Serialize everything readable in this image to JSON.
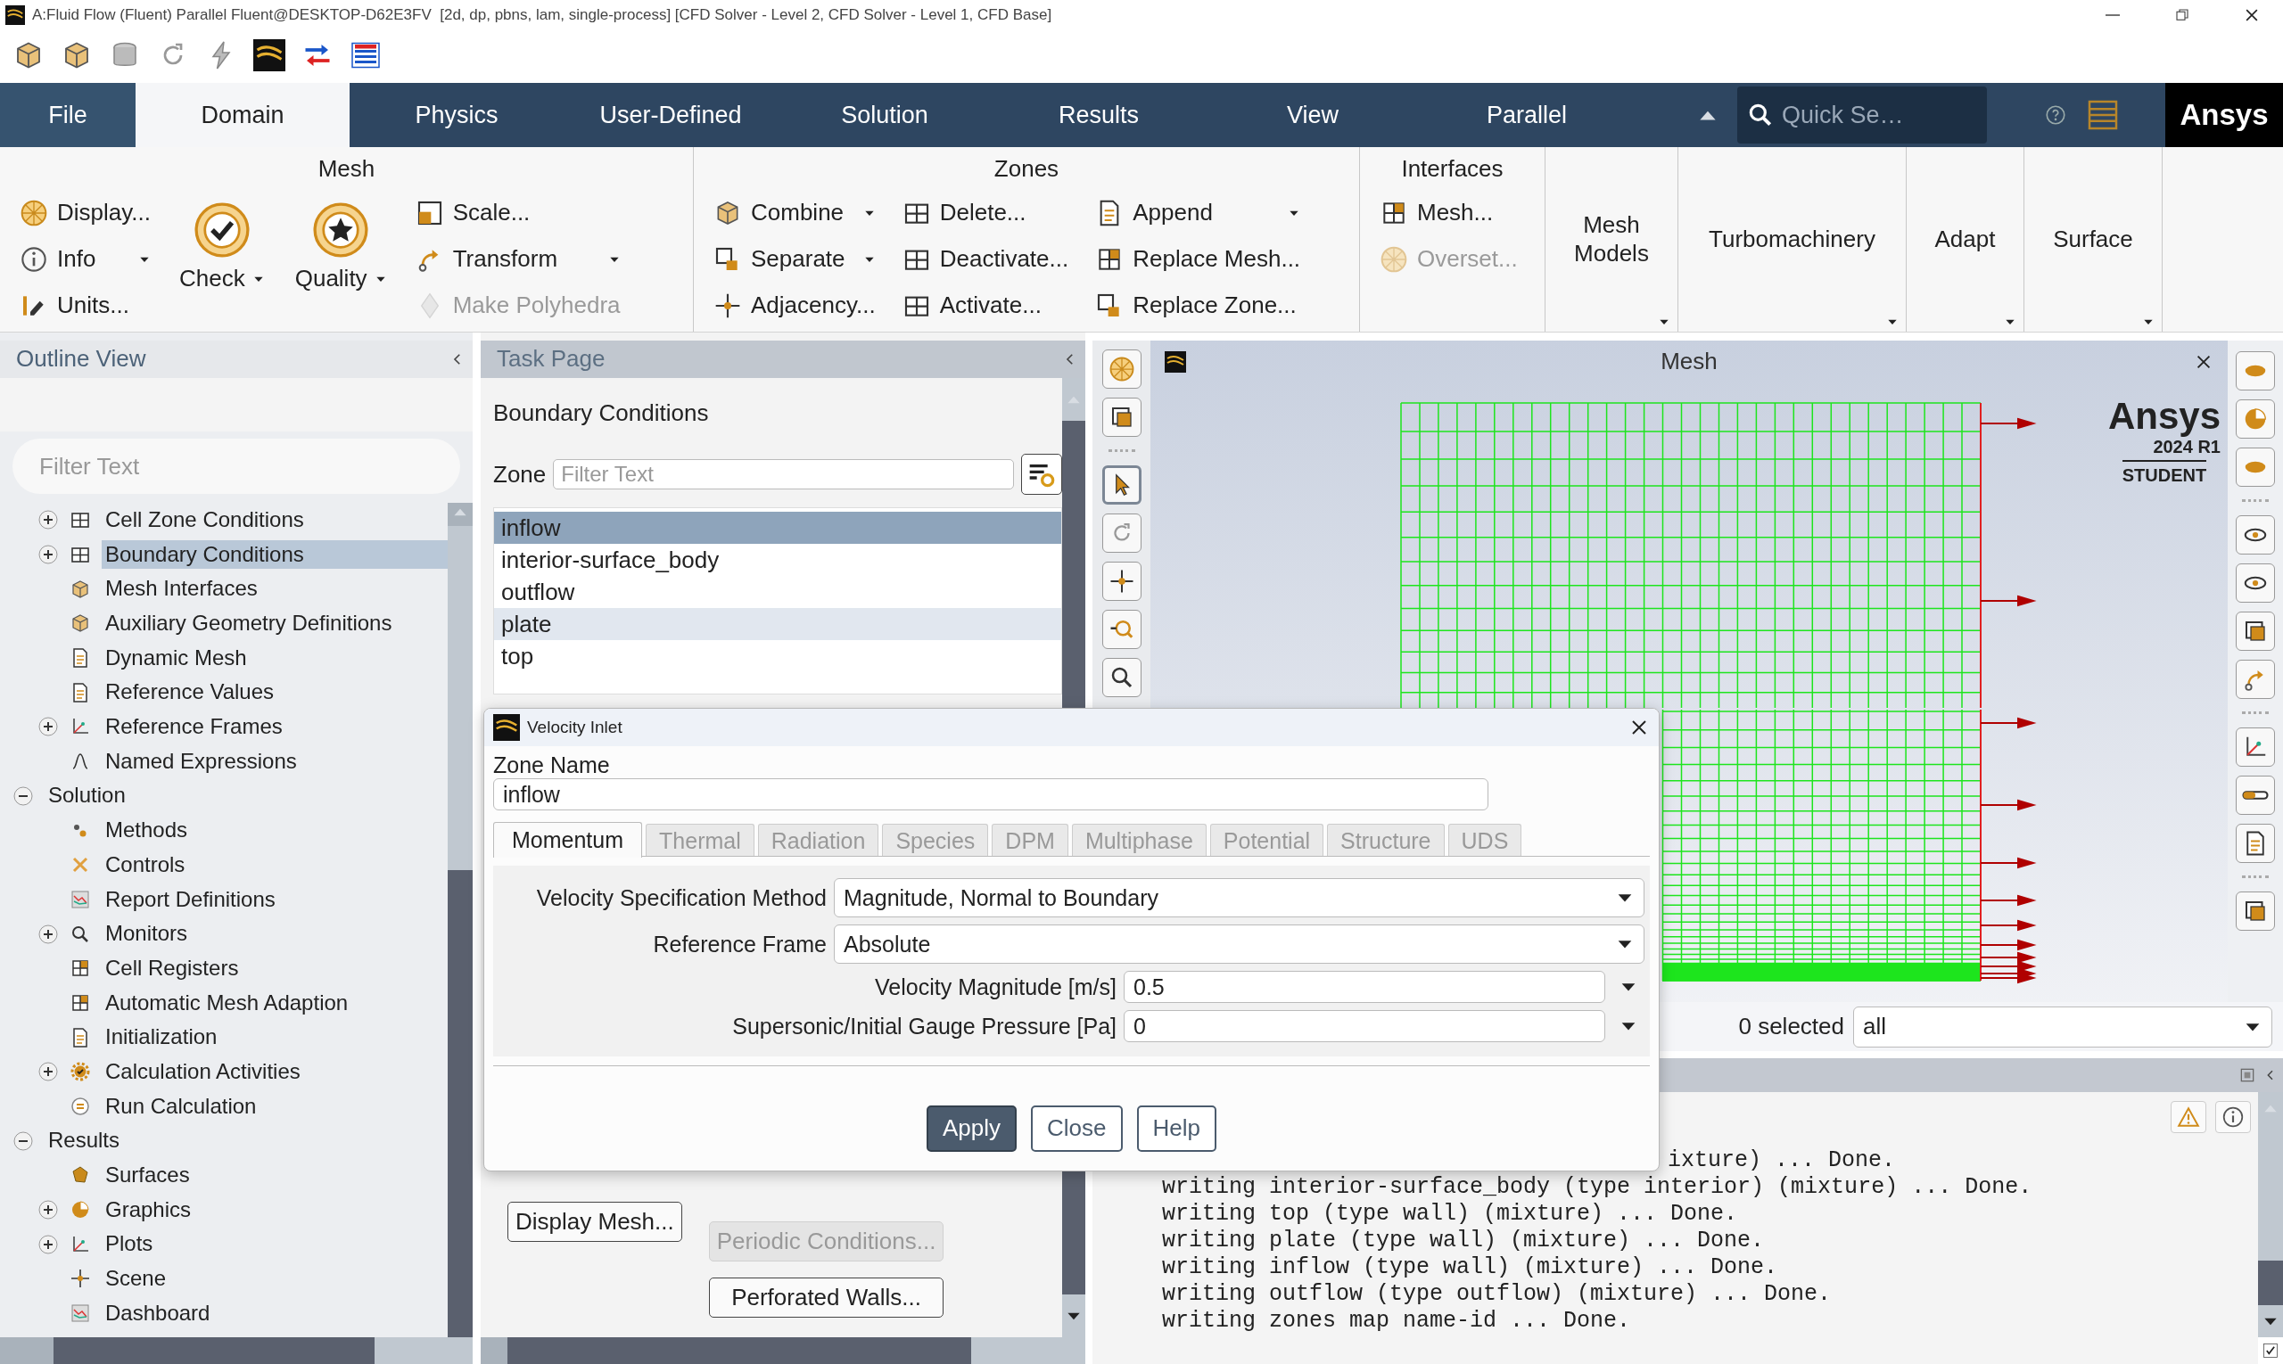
{
  "window": {
    "title": "A:Fluid Flow (Fluent) Parallel Fluent@DESKTOP-D62E3FV  [2d, dp, pbns, lam, single-process] [CFD Solver - Level 2, CFD Solver - Level 1, CFD Base]"
  },
  "ribbon": {
    "tabs": [
      {
        "label": "File",
        "selected": false
      },
      {
        "label": "Domain",
        "selected": true
      },
      {
        "label": "Physics",
        "selected": false
      },
      {
        "label": "User-Defined",
        "selected": false
      },
      {
        "label": "Solution",
        "selected": false
      },
      {
        "label": "Results",
        "selected": false
      },
      {
        "label": "View",
        "selected": false
      },
      {
        "label": "Parallel",
        "selected": false
      }
    ],
    "search": {
      "placeholder": "Quick Se…"
    },
    "logo": "Ansys",
    "groups": [
      {
        "title": "Mesh",
        "kind": "expanded",
        "columns": [
          {
            "kind": "stack",
            "items": [
              {
                "label": "Display...",
                "dropdown": false,
                "disabled": false
              },
              {
                "label": "Info",
                "dropdown": true,
                "disabled": false
              },
              {
                "label": "Units...",
                "dropdown": false,
                "disabled": false
              }
            ]
          },
          {
            "kind": "large",
            "label": "Check",
            "dropdown": true
          },
          {
            "kind": "large",
            "label": "Quality",
            "dropdown": true
          },
          {
            "kind": "stack",
            "items": [
              {
                "label": "Scale...",
                "dropdown": false,
                "disabled": false
              },
              {
                "label": "Transform",
                "dropdown": true,
                "disabled": false
              },
              {
                "label": "Make Polyhedra",
                "dropdown": false,
                "disabled": true
              }
            ]
          }
        ]
      },
      {
        "title": "Zones",
        "kind": "expanded",
        "columns": [
          {
            "kind": "stack",
            "items": [
              {
                "label": "Combine",
                "dropdown": true,
                "disabled": false
              },
              {
                "label": "Separate",
                "dropdown": true,
                "disabled": false
              },
              {
                "label": "Adjacency...",
                "dropdown": false,
                "disabled": false
              }
            ]
          },
          {
            "kind": "stack",
            "items": [
              {
                "label": "Delete...",
                "dropdown": false,
                "disabled": false
              },
              {
                "label": "Deactivate...",
                "dropdown": false,
                "disabled": false
              },
              {
                "label": "Activate...",
                "dropdown": false,
                "disabled": false
              }
            ]
          },
          {
            "kind": "stack",
            "items": [
              {
                "label": "Append",
                "dropdown": true,
                "disabled": false
              },
              {
                "label": "Replace Mesh...",
                "dropdown": false,
                "disabled": false
              },
              {
                "label": "Replace Zone...",
                "dropdown": false,
                "disabled": false
              }
            ]
          }
        ]
      },
      {
        "title": "Interfaces",
        "kind": "expanded",
        "columns": [
          {
            "kind": "stack",
            "items": [
              {
                "label": "Mesh...",
                "dropdown": false,
                "disabled": false
              },
              {
                "label": "Overset...",
                "dropdown": false,
                "disabled": true
              }
            ]
          }
        ]
      },
      {
        "title": "Mesh Models",
        "kind": "collapsed"
      },
      {
        "title": "Turbomachinery",
        "kind": "collapsed"
      },
      {
        "title": "Adapt",
        "kind": "collapsed"
      },
      {
        "title": "Surface",
        "kind": "collapsed"
      }
    ]
  },
  "outline": {
    "title": "Outline View",
    "filter": {
      "placeholder": "Filter Text"
    },
    "tree": [
      {
        "children": [
          {
            "label": "Cell Zone Conditions",
            "expanded": false,
            "selected": false
          },
          {
            "label": "Boundary Conditions",
            "expanded": false,
            "selected": true
          },
          {
            "label": "Mesh Interfaces",
            "selected": false
          },
          {
            "label": "Auxiliary Geometry Definitions",
            "selected": false
          },
          {
            "label": "Dynamic Mesh",
            "selected": false
          },
          {
            "label": "Reference Values",
            "selected": false
          },
          {
            "label": "Reference Frames",
            "expanded": false,
            "selected": false
          },
          {
            "label": "Named Expressions",
            "selected": false
          }
        ]
      },
      {
        "label": "Solution",
        "expanded": true,
        "selected": false,
        "children": [
          {
            "label": "Methods",
            "selected": false
          },
          {
            "label": "Controls",
            "selected": false
          },
          {
            "label": "Report Definitions",
            "selected": false
          },
          {
            "label": "Monitors",
            "expanded": false,
            "selected": false
          },
          {
            "label": "Cell Registers",
            "selected": false
          },
          {
            "label": "Automatic Mesh Adaption",
            "selected": false
          },
          {
            "label": "Initialization",
            "selected": false
          },
          {
            "label": "Calculation Activities",
            "expanded": false,
            "selected": false
          },
          {
            "label": "Run Calculation",
            "selected": false
          }
        ]
      },
      {
        "label": "Results",
        "expanded": true,
        "selected": false,
        "children": [
          {
            "label": "Surfaces",
            "selected": false
          },
          {
            "label": "Graphics",
            "expanded": false,
            "selected": false
          },
          {
            "label": "Plots",
            "expanded": false,
            "selected": false
          },
          {
            "label": "Scene",
            "selected": false
          },
          {
            "label": "Dashboard",
            "selected": false
          }
        ]
      }
    ]
  },
  "task_page": {
    "title": "Task Page",
    "heading": "Boundary Conditions",
    "zone_label": "Zone",
    "zone_filter": {
      "placeholder": "Filter Text"
    },
    "zones": [
      {
        "label": "inflow",
        "selected": true,
        "highlighted": false
      },
      {
        "label": "interior-surface_body",
        "selected": false,
        "highlighted": false
      },
      {
        "label": "outflow",
        "selected": false,
        "highlighted": false
      },
      {
        "label": "plate",
        "selected": false,
        "highlighted": true
      },
      {
        "label": "top",
        "selected": false,
        "highlighted": false
      }
    ],
    "buttons": [
      {
        "label": "Display Mesh...",
        "disabled": false
      },
      {
        "label": "Periodic Conditions...",
        "disabled": true
      },
      {
        "label": "Perforated Walls...",
        "disabled": false
      }
    ]
  },
  "graphics": {
    "title": "Mesh",
    "logo": {
      "brand": "Ansys",
      "version": "2024 R1",
      "edition": "STUDENT"
    },
    "selection": {
      "count": "0 selected",
      "filter": "all"
    }
  },
  "console": {
    "lines": [
      "ixture) ... Done.",
      "writing interior-surface_body (type interior) (mixture) ... Done.",
      "writing top (type wall) (mixture) ... Done.",
      "writing plate (type wall) (mixture) ... Done.",
      "writing inflow (type wall) (mixture) ... Done.",
      "writing outflow (type outflow) (mixture) ... Done.",
      "writing zones map name-id ... Done."
    ]
  },
  "dialog": {
    "title": "Velocity Inlet",
    "zone_name_label": "Zone Name",
    "zone_name": "inflow",
    "tabs": [
      {
        "label": "Momentum",
        "selected": true
      },
      {
        "label": "Thermal",
        "selected": false
      },
      {
        "label": "Radiation",
        "selected": false
      },
      {
        "label": "Species",
        "selected": false
      },
      {
        "label": "DPM",
        "selected": false
      },
      {
        "label": "Multiphase",
        "selected": false
      },
      {
        "label": "Potential",
        "selected": false
      },
      {
        "label": "Structure",
        "selected": false
      },
      {
        "label": "UDS",
        "selected": false
      }
    ],
    "fields": [
      {
        "kind": "select",
        "label": "Velocity Specification Method",
        "value": "Magnitude, Normal to Boundary"
      },
      {
        "kind": "select",
        "label": "Reference Frame",
        "value": "Absolute"
      },
      {
        "kind": "input",
        "label": "Velocity Magnitude [m/s]",
        "value": "0.5"
      },
      {
        "kind": "input",
        "label": "Supersonic/Initial Gauge Pressure [Pa]",
        "value": "0"
      }
    ],
    "buttons": [
      {
        "label": "Apply",
        "primary": true
      },
      {
        "label": "Close",
        "primary": false
      },
      {
        "label": "Help",
        "primary": false
      }
    ]
  }
}
